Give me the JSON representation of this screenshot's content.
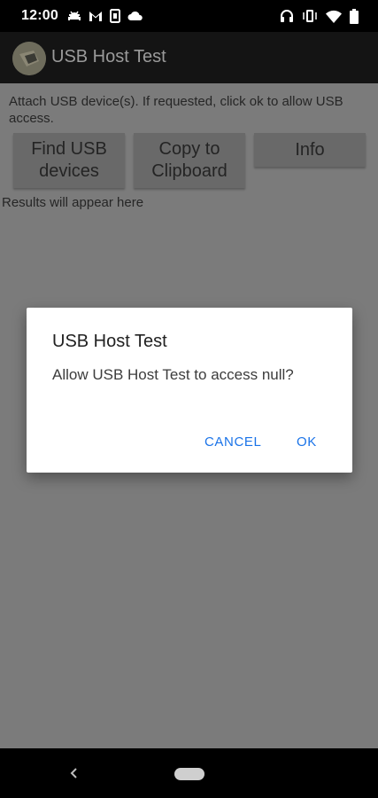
{
  "status_bar": {
    "time": "12:00",
    "left_icons": [
      "android-debug-icon",
      "gmail-icon",
      "sim-card-icon",
      "cloud-icon"
    ],
    "right_icons": [
      "headset-icon",
      "vibrate-icon",
      "wifi-icon",
      "battery-icon"
    ]
  },
  "app_bar": {
    "title": "USB Host Test",
    "icon": "app-logo-icon"
  },
  "main": {
    "instructions": "Attach USB device(s).  If requested, click ok to allow USB access.",
    "buttons": {
      "find_line1": "Find USB",
      "find_line2": "devices",
      "copy_line1": "Copy to",
      "copy_line2": "Clipboard",
      "info": "Info"
    },
    "results": "Results will appear here"
  },
  "dialog": {
    "title": "USB Host Test",
    "message": "Allow USB Host Test to access null?",
    "cancel": "CANCEL",
    "ok": "OK",
    "accent_color": "#1a73e8"
  },
  "nav_bar": {
    "back_icon": "back-chevron-icon",
    "home_icon": "home-pill-icon"
  }
}
